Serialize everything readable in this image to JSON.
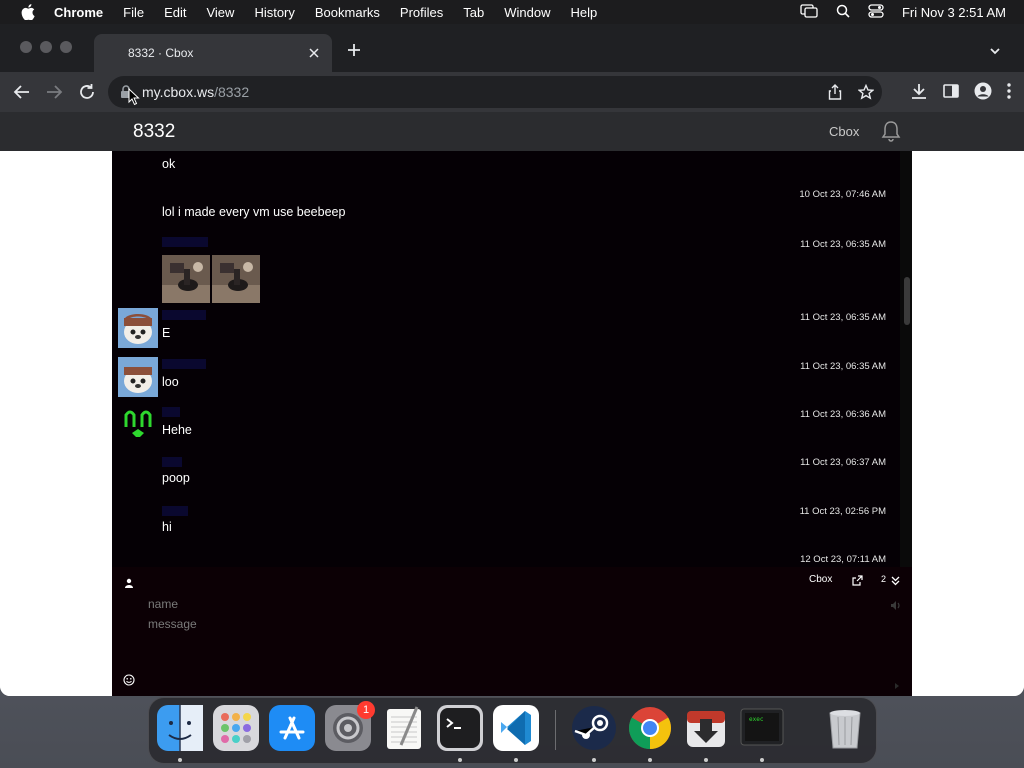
{
  "menubar": {
    "app_name": "Chrome",
    "menus": [
      "File",
      "Edit",
      "View",
      "History",
      "Bookmarks",
      "Profiles",
      "Tab",
      "Window",
      "Help"
    ],
    "clock": "Fri Nov 3  2:51 AM"
  },
  "browser": {
    "tab_title": "8332 · Cbox",
    "url_host": "my.cbox.ws",
    "url_path": "/8332"
  },
  "app": {
    "room_name": "8332",
    "brand": "Cbox"
  },
  "messages": [
    {
      "text": "ok",
      "time": ""
    },
    {
      "text": "lol i made every vm use beebeep",
      "time": "10 Oct 23, 07:46 AM"
    },
    {
      "sender": "",
      "text": "",
      "time": "11 Oct 23, 06:35 AM",
      "images": 2
    },
    {
      "sender": "",
      "text": "E",
      "time": "11 Oct 23, 06:35 AM",
      "avatar": "puppy-avatar"
    },
    {
      "sender": "",
      "text": "loo",
      "time": "11 Oct 23, 06:35 AM",
      "avatar": "puppy-avatar"
    },
    {
      "sender": "",
      "text": "Hehe",
      "time": "11 Oct 23, 06:36 AM",
      "avatar": "green-face-avatar"
    },
    {
      "sender": "",
      "text": "poop",
      "time": "11 Oct 23, 06:37 AM"
    },
    {
      "sender": "",
      "text": "hi",
      "time": "11 Oct 23, 02:56 PM"
    },
    {
      "text": "",
      "time": "12 Oct 23, 07:11 AM"
    }
  ],
  "composer": {
    "cbox_link": "Cbox",
    "count": "2",
    "name_placeholder": "name",
    "message_placeholder": "message"
  },
  "dock": {
    "apps": [
      "finder-icon",
      "launchpad-icon",
      "app-store-icon",
      "system-settings-icon",
      "textedit-icon",
      "terminal-icon",
      "vscode-icon",
      "steam-icon",
      "chrome-icon",
      "installer-icon",
      "exec-terminal-icon",
      "trash-icon"
    ],
    "settings_badge": "1"
  },
  "colors": {
    "chat_bg": "#050005",
    "sender_link": "#2a2ab0",
    "header_bg": "#2b2c2f"
  }
}
